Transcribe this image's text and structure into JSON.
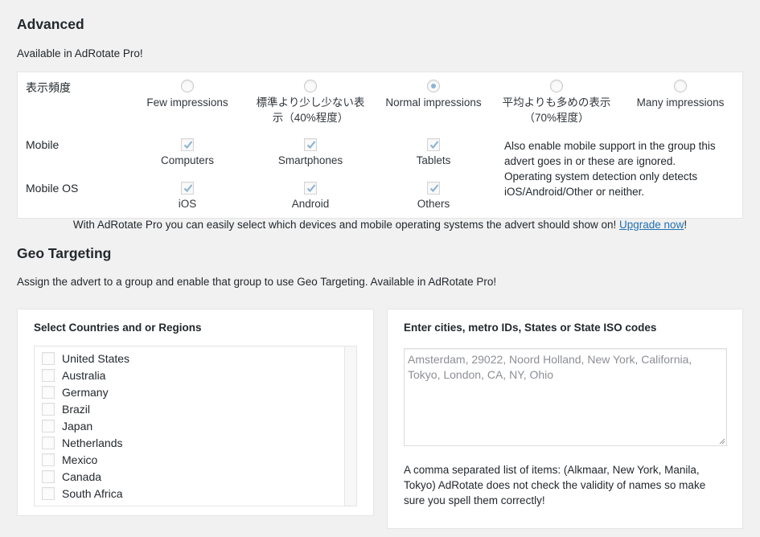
{
  "advanced": {
    "heading": "Advanced",
    "availability": "Available in AdRotate Pro!",
    "frequency": {
      "label": "表示頻度",
      "options": [
        {
          "line1": "Few impressions",
          "line2": "",
          "checked": false
        },
        {
          "line1": "標準より少し少ない表",
          "line2": "示（40%程度）",
          "checked": false
        },
        {
          "line1": "Normal impressions",
          "line2": "",
          "checked": true
        },
        {
          "line1": "平均よりも多めの表示",
          "line2": "（70%程度）",
          "checked": false
        },
        {
          "line1": "Many impressions",
          "line2": "",
          "checked": false
        }
      ]
    },
    "mobile": {
      "label": "Mobile",
      "options": [
        {
          "label": "Computers",
          "checked": true
        },
        {
          "label": "Smartphones",
          "checked": true
        },
        {
          "label": "Tablets",
          "checked": true
        }
      ]
    },
    "mobile_os": {
      "label": "Mobile OS",
      "options": [
        {
          "label": "iOS",
          "checked": true
        },
        {
          "label": "Android",
          "checked": true
        },
        {
          "label": "Others",
          "checked": true
        }
      ]
    },
    "note_line1": "Also enable mobile support in the group this",
    "note_line2": "advert goes in or these are ignored.",
    "note_line3": "Operating system detection only detects",
    "note_line4": "iOS/Android/Other or neither.",
    "promo_text": "With AdRotate Pro you can easily select which devices and mobile operating systems the advert should show on!",
    "promo_link": "Upgrade now",
    "promo_suffix": "!"
  },
  "geo": {
    "heading": "Geo Targeting",
    "description": "Assign the advert to a group and enable that group to use Geo Targeting. Available in AdRotate Pro!",
    "countries_title": "Select Countries and or Regions",
    "countries": [
      "United States",
      "Australia",
      "Germany",
      "Brazil",
      "Japan",
      "Netherlands",
      "Mexico",
      "Canada",
      "South Africa"
    ],
    "cities_title": "Enter cities, metro IDs, States or State ISO codes",
    "cities_placeholder": "Amsterdam, 29022, Noord Holland, New York, California, Tokyo, London, CA, NY, Ohio",
    "cities_note": "A comma separated list of items: (Alkmaar, New York, Manila, Tokyo) AdRotate does not check the validity of names so make sure you spell them correctly!"
  },
  "colors": {
    "accent": "#2271b1",
    "check": "#8cb4d4",
    "background": "#f1f1f1"
  }
}
